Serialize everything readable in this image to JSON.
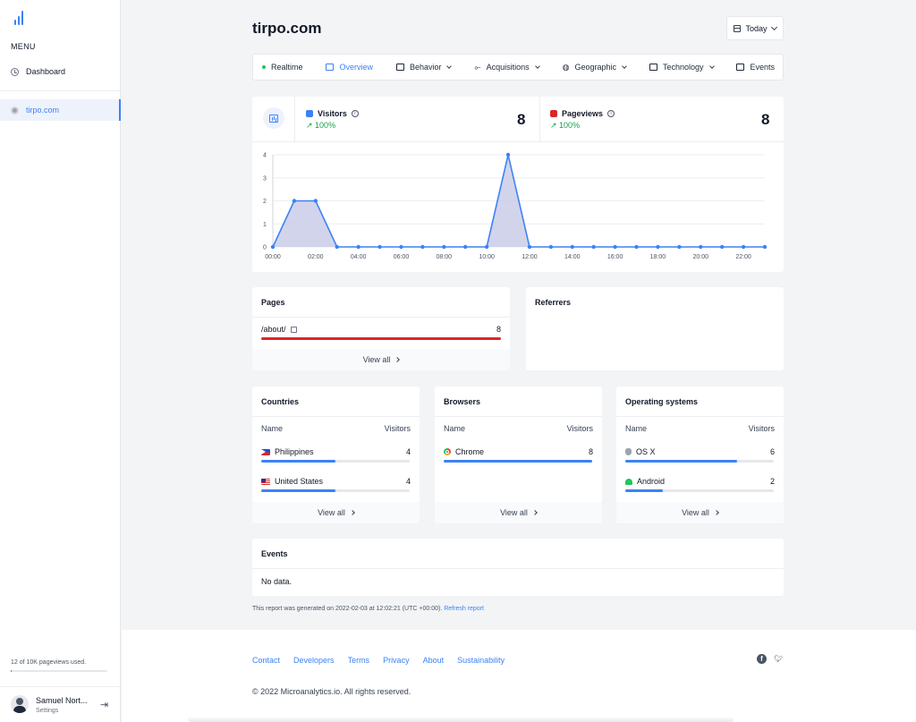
{
  "sidebar": {
    "menu_label": "MENU",
    "dashboard_label": "Dashboard",
    "site_label": "tirpo.com",
    "usage_text": "12 of 10K pageviews used.",
    "usage_fraction": 0.0012,
    "user_name": "Samuel Nort...",
    "user_sub": "Settings"
  },
  "header": {
    "title": "tirpo.com",
    "date_button": "Today"
  },
  "tabs": {
    "realtime": "Realtime",
    "overview": "Overview",
    "behavior": "Behavior",
    "acquisitions": "Acquisitions",
    "geographic": "Geographic",
    "technology": "Technology",
    "events": "Events"
  },
  "stats": {
    "visitors": {
      "label": "Visitors",
      "change": "100%",
      "value": "8",
      "color": "#3b82f6"
    },
    "pageviews": {
      "label": "Pageviews",
      "change": "100%",
      "value": "8",
      "color": "#dc2626"
    }
  },
  "chart_data": {
    "type": "area",
    "x": [
      "00:00",
      "01:00",
      "02:00",
      "03:00",
      "04:00",
      "05:00",
      "06:00",
      "07:00",
      "08:00",
      "09:00",
      "10:00",
      "11:00",
      "12:00",
      "13:00",
      "14:00",
      "15:00",
      "16:00",
      "17:00",
      "18:00",
      "19:00",
      "20:00",
      "21:00",
      "22:00",
      "23:00"
    ],
    "series": [
      {
        "values": [
          0,
          2,
          2,
          0,
          0,
          0,
          0,
          0,
          0,
          0,
          0,
          4,
          0,
          0,
          0,
          0,
          0,
          0,
          0,
          0,
          0,
          0,
          0,
          0
        ]
      }
    ],
    "x_ticks": [
      "00:00",
      "02:00",
      "04:00",
      "06:00",
      "08:00",
      "10:00",
      "12:00",
      "14:00",
      "16:00",
      "18:00",
      "20:00",
      "22:00"
    ],
    "y_ticks": [
      "0",
      "1",
      "2",
      "3",
      "4"
    ],
    "ylim": [
      0,
      4
    ],
    "grid": true,
    "line_color": "#3b82f6",
    "fill_color": "#c7c9e6"
  },
  "pages": {
    "title": "Pages",
    "rows": [
      {
        "path": "/about/",
        "count": "8",
        "fraction": 1.0
      }
    ],
    "view_all": "View all"
  },
  "referrers": {
    "title": "Referrers"
  },
  "countries": {
    "title": "Countries",
    "col_name": "Name",
    "col_visitors": "Visitors",
    "rows": [
      {
        "name": "Philippines",
        "count": "4",
        "fraction": 0.5
      },
      {
        "name": "United States",
        "count": "4",
        "fraction": 0.5
      }
    ],
    "view_all": "View all"
  },
  "browsers": {
    "title": "Browsers",
    "col_name": "Name",
    "col_visitors": "Visitors",
    "rows": [
      {
        "name": "Chrome",
        "count": "8",
        "fraction": 1.0
      }
    ],
    "view_all": "View all"
  },
  "os": {
    "title": "Operating systems",
    "col_name": "Name",
    "col_visitors": "Visitors",
    "rows": [
      {
        "name": "OS X",
        "count": "6",
        "fraction": 0.75
      },
      {
        "name": "Android",
        "count": "2",
        "fraction": 0.25
      }
    ],
    "view_all": "View all"
  },
  "events": {
    "title": "Events",
    "empty": "No data."
  },
  "report": {
    "text": "This report was generated on 2022-02-03 at 12:02:21 (UTC +00:00).",
    "refresh": "Refresh report"
  },
  "footer": {
    "links": [
      "Contact",
      "Developers",
      "Terms",
      "Privacy",
      "About",
      "Sustainability"
    ],
    "copyright": "© 2022 Microanalytics.io. All rights reserved."
  },
  "colors": {
    "accent": "#3b82f6",
    "danger": "#dc2626",
    "success": "#16a34a"
  }
}
